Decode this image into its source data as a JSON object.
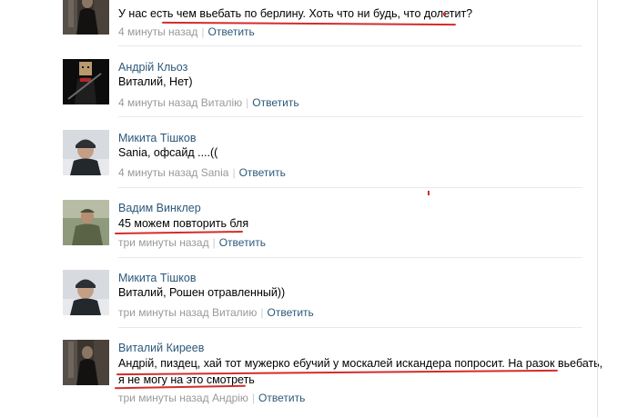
{
  "comments": [
    {
      "author": "",
      "text": "У нас есть чем вьебать по берлину. Хоть что ни будь, что долетит?",
      "time": "4 минуты назад",
      "reply_to": "",
      "reply_label": "Ответить",
      "avatar": "dark-figure-photo"
    },
    {
      "author": "Андрій Кльоз",
      "text": "Виталий, Нет)",
      "time": "4 минуты назад",
      "reply_to": "Виталію",
      "reply_label": "Ответить",
      "avatar": "paper-bag-head-photo"
    },
    {
      "author": "Микита Тішков",
      "text": "Sania, офсайд ....((",
      "time": "4 минуты назад",
      "reply_to": "Sania",
      "reply_label": "Ответить",
      "avatar": "man-in-hat-photo"
    },
    {
      "author": "Вадим Винклер",
      "text": "45 можем повторить бля",
      "time": "три минуты назад",
      "reply_to": "",
      "reply_label": "Ответить",
      "avatar": "soldier-photo"
    },
    {
      "author": "Микита Тішков",
      "text": "Виталий, Рошен отравленный))",
      "time": "три минуты назад",
      "reply_to": "Виталию",
      "reply_label": "Ответить",
      "avatar": "man-in-hat-photo"
    },
    {
      "author": "Виталий Киреев",
      "text_line1": "Андрій, пиздец, хай тот мужерко ебучий у москалей искандера попросит. На разок вьебать,",
      "text_line2": "я не могу на это смотреть",
      "time": "три минуты назад",
      "reply_to": "Андрію",
      "reply_label": "Ответить",
      "avatar": "dark-figure-photo"
    }
  ],
  "colors": {
    "link": "#2b587a",
    "meta": "#999999",
    "annotation": "#d42c2c"
  }
}
